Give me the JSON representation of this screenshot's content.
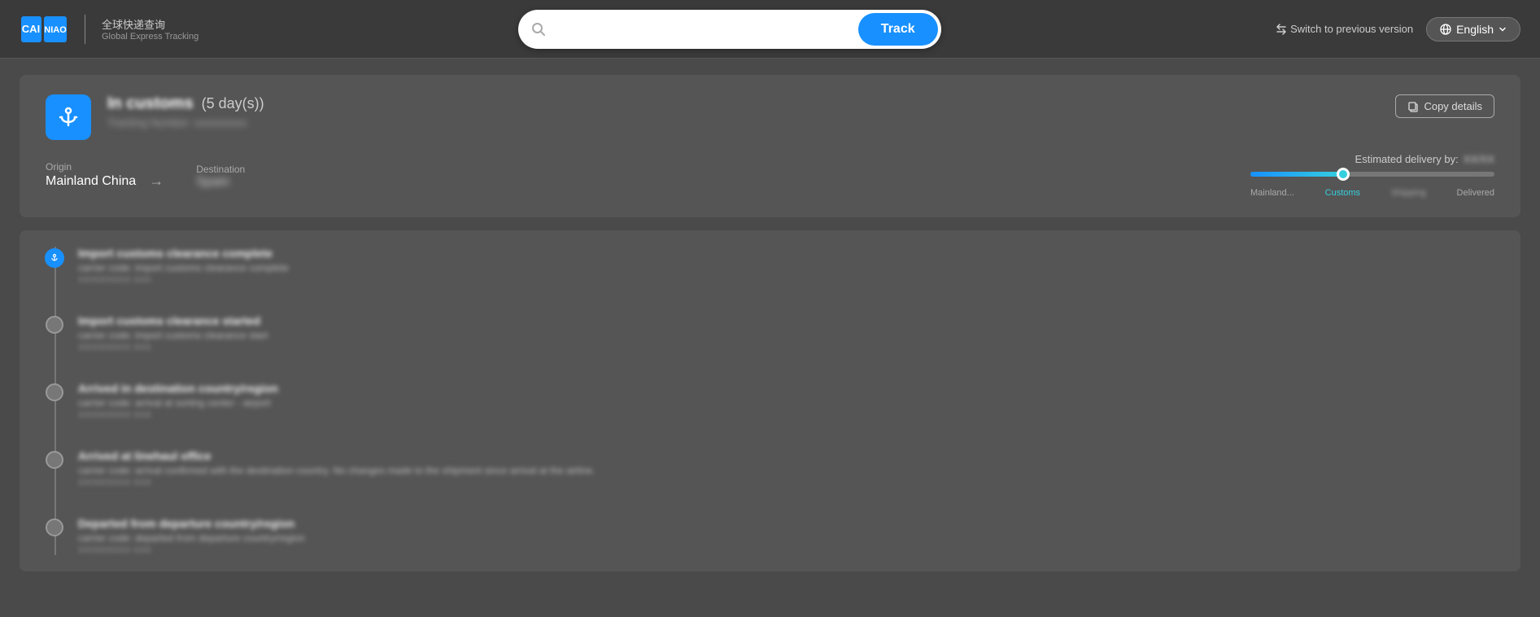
{
  "header": {
    "logo_cn_text": "全球快递查询",
    "logo_en_text": "Global Express Tracking",
    "search_placeholder": "",
    "track_button_label": "Track",
    "switch_version_label": "Switch to previous version",
    "lang_label": "English"
  },
  "tracking": {
    "status_text": "In customs",
    "days_text": "(5 day(s))",
    "tracking_number": "Tracking Number: xxxxxxxxxx",
    "copy_details_label": "Copy details",
    "origin_label": "Origin",
    "origin_value": "Mainland China",
    "destination_label": "Destination",
    "destination_value": "Spain",
    "estimated_delivery_label": "Estimated delivery by:",
    "estimated_date": "XX/XX",
    "progress_labels": {
      "mainland": "Mainland...",
      "customs": "Customs",
      "shipping": "Shipping",
      "delivered": "Delivered"
    }
  },
  "timeline": {
    "items": [
      {
        "title": "Import customs clearance complete",
        "subtitle": "carrier code: import customs clearance complete",
        "time": "XX/XX/XXXX XXX",
        "active": true,
        "icon": true
      },
      {
        "title": "Import customs clearance started",
        "subtitle": "carrier code: import customs clearance start",
        "time": "XX/XX/XXXX XXX",
        "active": false,
        "icon": false
      },
      {
        "title": "Arrived in destination country/region",
        "subtitle": "carrier code: arrival at sorting center - airport",
        "time": "XX/XX/XXXX XXX",
        "active": false,
        "icon": false
      },
      {
        "title": "Arrived at linehaul office",
        "subtitle": "carrier code: arrival confirmed with the destination country. No changes made to the shipment since arrival at the airline.",
        "time": "XX/XX/XXXX XXX",
        "active": false,
        "icon": false
      },
      {
        "title": "Departed from departure country/region",
        "subtitle": "carrier code: departed from departure country/region",
        "time": "XX/XX/XXXX XXX",
        "active": false,
        "icon": false
      }
    ]
  }
}
